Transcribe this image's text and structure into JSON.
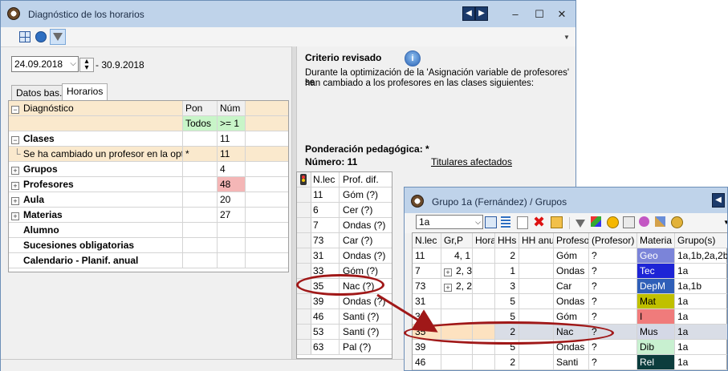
{
  "win1": {
    "title": "Diagnóstico de los horarios",
    "nav_prev": "◀",
    "nav_next": "▶",
    "minimize": "–",
    "maximize": "☐",
    "close": "✕",
    "toolbar_icons": [
      "grid-icon",
      "refresh-icon",
      "filter-icon"
    ],
    "date_from": "24.09.2018",
    "date_to": "- 30.9.2018",
    "tabs": [
      "Datos bas.",
      "Horarios"
    ],
    "grid": {
      "headers": [
        "Diagnóstico",
        "Pon",
        "Núm"
      ],
      "filter_row": [
        "",
        "Todos",
        ">= 1"
      ],
      "rows": [
        {
          "expander": "−",
          "label": "Clases",
          "pon": "",
          "num": "11",
          "bold": true
        },
        {
          "expander": "",
          "label": "Se ha cambiado un profesor en la opt.",
          "pon": "*",
          "num": "11",
          "bold": false,
          "child": true
        },
        {
          "expander": "+",
          "label": "Grupos",
          "pon": "",
          "num": "4",
          "bold": true
        },
        {
          "expander": "+",
          "label": "Profesores",
          "pon": "",
          "num": "48",
          "bold": true,
          "highlight": "#f4b6b6"
        },
        {
          "expander": "+",
          "label": "Aula",
          "pon": "",
          "num": "20",
          "bold": true
        },
        {
          "expander": "+",
          "label": "Materias",
          "pon": "",
          "num": "27",
          "bold": true
        },
        {
          "expander": "",
          "label": "Alumno",
          "pon": "",
          "num": "",
          "bold": true
        },
        {
          "expander": "",
          "label": "Sucesiones obligatorias",
          "pon": "",
          "num": "",
          "bold": true
        },
        {
          "expander": "",
          "label": "Calendario - Planif. anual",
          "pon": "",
          "num": "",
          "bold": true
        }
      ]
    },
    "criterio": {
      "title": "Criterio revisado",
      "text1": "Durante la optimización de la 'Asignación variable de profesores' se",
      "text2": "han cambiado a los profesores en las clases siguientes:",
      "ponderacion": "Ponderación pedagógica: *",
      "numero": "Número: 11",
      "titulares": "Titulares afectados"
    },
    "lessons": {
      "headers": [
        "N.lec",
        "Prof. dif."
      ],
      "rows": [
        [
          "11",
          "Góm (?)"
        ],
        [
          "6",
          "Cer (?)"
        ],
        [
          "7",
          "Ondas (?)"
        ],
        [
          "73",
          "Car (?)"
        ],
        [
          "31",
          "Ondas (?)"
        ],
        [
          "33",
          "Góm (?)"
        ],
        [
          "35",
          "Nac (?)"
        ],
        [
          "39",
          "Ondas (?)"
        ],
        [
          "46",
          "Santi (?)"
        ],
        [
          "53",
          "Santi (?)"
        ],
        [
          "63",
          "Pal (?)"
        ]
      ]
    }
  },
  "win2": {
    "title": "Grupo 1a (Fernández) / Grupos",
    "nav_prev": "◀",
    "combo_value": "1a",
    "headers": [
      "N.lec",
      "Gr,P",
      "Horas",
      "HHs",
      "HH anual",
      "Profesor",
      "(Profesor)",
      "Materia",
      "Grupo(s)"
    ],
    "rows": [
      {
        "nlec": "11",
        "gr": "4, 1",
        "exp": "",
        "horas": "",
        "hhs": "2",
        "hh": "",
        "prof": "Góm",
        "pprof": "?",
        "mat": "Geo",
        "matcolor": "#7b84d9",
        "matfg": "#ffffff",
        "grupos": "1a,1b,2a,2b"
      },
      {
        "nlec": "7",
        "gr": "2, 3",
        "exp": "+",
        "horas": "",
        "hhs": "1",
        "hh": "",
        "prof": "Ondas",
        "pprof": "?",
        "mat": "Tec",
        "matcolor": "#1d24d6",
        "matfg": "#ffffff",
        "grupos": "1a"
      },
      {
        "nlec": "73",
        "gr": "2, 2",
        "exp": "+",
        "horas": "",
        "hhs": "3",
        "hh": "",
        "prof": "Car",
        "pprof": "?",
        "mat": "DepM",
        "matcolor": "#2f5fb8",
        "matfg": "#ffffff",
        "grupos": "1a,1b"
      },
      {
        "nlec": "31",
        "gr": "",
        "exp": "",
        "horas": "",
        "hhs": "5",
        "hh": "",
        "prof": "Ondas",
        "pprof": "?",
        "mat": "Mat",
        "matcolor": "#c0c000",
        "matfg": "#000000",
        "grupos": "1a"
      },
      {
        "nlec": "33",
        "gr": "",
        "exp": "",
        "horas": "",
        "hhs": "5",
        "hh": "",
        "prof": "Góm",
        "pprof": "?",
        "mat": "I",
        "matcolor": "#f07b7b",
        "matfg": "#000000",
        "grupos": "1a"
      },
      {
        "nlec": "35",
        "gr": "",
        "exp": "",
        "horas": "",
        "hhs": "2",
        "hh": "",
        "prof": "Nac",
        "pprof": "?",
        "mat": "Mus",
        "matcolor": "#d4d8e6",
        "matfg": "#000000",
        "grupos": "1a",
        "selected": true
      },
      {
        "nlec": "39",
        "gr": "",
        "exp": "",
        "horas": "",
        "hhs": "5",
        "hh": "",
        "prof": "Ondas",
        "pprof": "?",
        "mat": "Dib",
        "matcolor": "#c8f0d0",
        "matfg": "#000000",
        "grupos": "1a"
      },
      {
        "nlec": "46",
        "gr": "",
        "exp": "",
        "horas": "",
        "hhs": "2",
        "hh": "",
        "prof": "Santi",
        "pprof": "?",
        "mat": "Rel",
        "matcolor": "#0c3d3d",
        "matfg": "#ffffff",
        "grupos": "1a"
      }
    ]
  }
}
